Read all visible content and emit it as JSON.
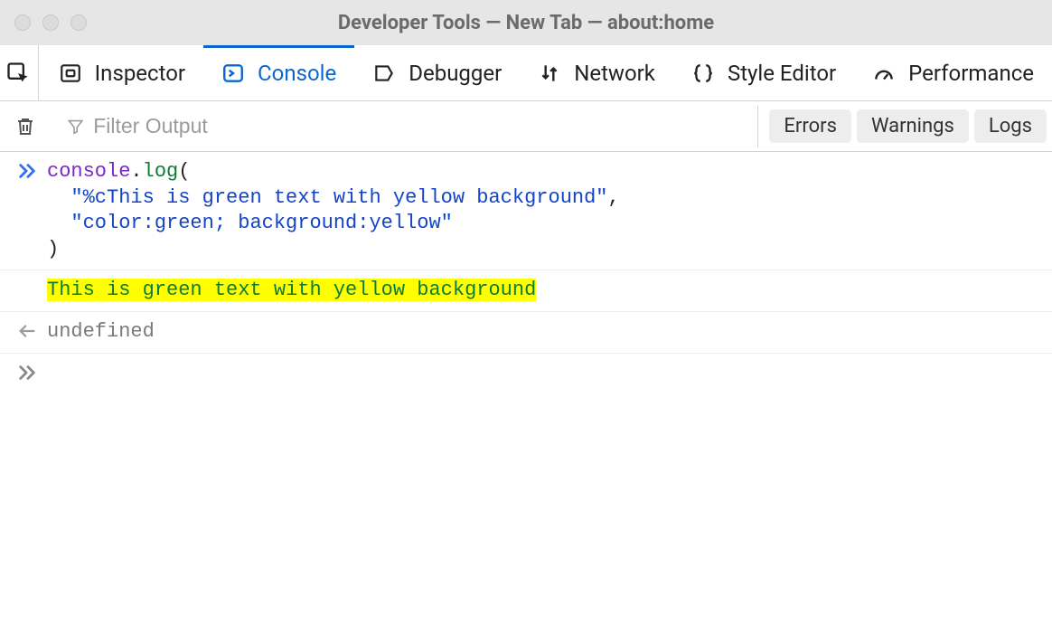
{
  "window": {
    "title": "Developer Tools — New Tab — about:home"
  },
  "tabs": [
    {
      "id": "inspector",
      "label": "Inspector"
    },
    {
      "id": "console",
      "label": "Console",
      "active": true
    },
    {
      "id": "debugger",
      "label": "Debugger"
    },
    {
      "id": "network",
      "label": "Network"
    },
    {
      "id": "styleeditor",
      "label": "Style Editor"
    },
    {
      "id": "performance",
      "label": "Performance"
    }
  ],
  "filter": {
    "placeholder": "Filter Output",
    "toggles": [
      "Errors",
      "Warnings",
      "Logs"
    ]
  },
  "input": {
    "obj": "console",
    "fn": "log",
    "arg1": "\"%cThis is green text with yellow background\"",
    "arg2": "\"color:green; background:yellow\""
  },
  "output": {
    "styledText": "This is green text with yellow background",
    "returnValue": "undefined"
  }
}
